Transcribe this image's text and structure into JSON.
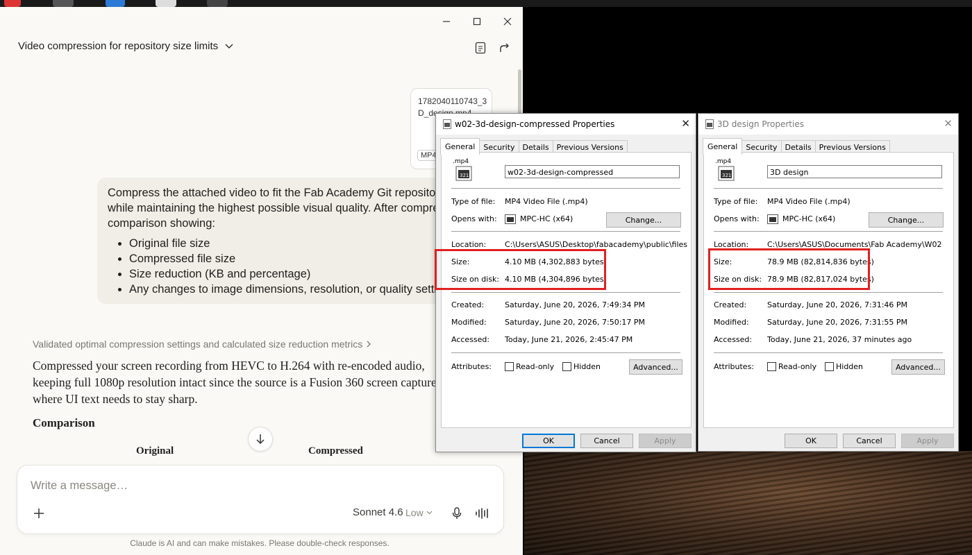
{
  "claude": {
    "title": "Video compression for repository size limits",
    "attachment": {
      "filename": "1782040110743_3D_design.mp4",
      "badge": "MP4"
    },
    "user_message": {
      "intro": "Compress the attached video to fit the Fab Academy Git repository size limits, while maintaining the highest possible visual quality. After compression, provide a comparison showing:",
      "items": [
        "Original file size",
        "Compressed file size",
        "Size reduction (KB and percentage)",
        "Any changes to image dimensions, resolution, or quality settings"
      ]
    },
    "thinking_summary": "Validated optimal compression settings and calculated size reduction metrics",
    "response_text": "Compressed your screen recording from HEVC to H.264 with re-encoded audio, keeping full 1080p resolution intact since the source is a Fusion 360 screen capture where UI text needs to stay sharp.",
    "response_heading": "Comparison",
    "table_headers": [
      "Original",
      "Compressed"
    ],
    "composer": {
      "placeholder": "Write a message…",
      "model": "Sonnet 4.6",
      "effort": "Low"
    },
    "disclaimer": "Claude is AI and can make mistakes. Please double-check responses."
  },
  "dialogs": [
    {
      "title": "w02-3d-design-compressed Properties",
      "tabs": [
        "General",
        "Security",
        "Details",
        "Previous Versions"
      ],
      "file_icon_ext": ".mp4",
      "file_name": "w02-3d-design-compressed",
      "type_label": "Type of file:",
      "type_value": "MP4 Video File (.mp4)",
      "opens_label": "Opens with:",
      "opens_value": "MPC-HC (x64)",
      "change_label": "Change...",
      "location_label": "Location:",
      "location_value": "C:\\Users\\ASUS\\Desktop\\fabacademy\\public\\files",
      "size_label": "Size:",
      "size_value": "4.10 MB (4,302,883 bytes)",
      "disk_label": "Size on disk:",
      "disk_value": "4.10 MB (4,304,896 bytes)",
      "created_label": "Created:",
      "created_value": "Saturday, June 20, 2026, 7:49:34 PM",
      "modified_label": "Modified:",
      "modified_value": "Saturday, June 20, 2026, 7:50:17 PM",
      "accessed_label": "Accessed:",
      "accessed_value": "Today, June 21, 2026, 2:45:47 PM",
      "attributes_label": "Attributes:",
      "readonly_label": "Read-only",
      "hidden_label": "Hidden",
      "advanced_label": "Advanced...",
      "ok_label": "OK",
      "cancel_label": "Cancel",
      "apply_label": "Apply"
    },
    {
      "title": "3D design Properties",
      "tabs": [
        "General",
        "Security",
        "Details",
        "Previous Versions"
      ],
      "file_icon_ext": ".mp4",
      "file_name": "3D design",
      "type_label": "Type of file:",
      "type_value": "MP4 Video File (.mp4)",
      "opens_label": "Opens with:",
      "opens_value": "MPC-HC (x64)",
      "change_label": "Change...",
      "location_label": "Location:",
      "location_value": "C:\\Users\\ASUS\\Documents\\Fab Academy\\W02",
      "size_label": "Size:",
      "size_value": "78.9 MB (82,814,836 bytes)",
      "disk_label": "Size on disk:",
      "disk_value": "78.9 MB (82,817,024 bytes)",
      "created_label": "Created:",
      "created_value": "Saturday, June 20, 2026, 7:31:46 PM",
      "modified_label": "Modified:",
      "modified_value": "Saturday, June 20, 2026, 7:31:55 PM",
      "accessed_label": "Accessed:",
      "accessed_value": "Today, June 21, 2026, 37 minutes ago",
      "attributes_label": "Attributes:",
      "readonly_label": "Read-only",
      "hidden_label": "Hidden",
      "advanced_label": "Advanced...",
      "ok_label": "OK",
      "cancel_label": "Cancel",
      "apply_label": "Apply"
    }
  ],
  "colors": {
    "highlight_box": "#e02020",
    "claude_bg": "#faf9f5",
    "user_bubble": "#f0eee6"
  }
}
